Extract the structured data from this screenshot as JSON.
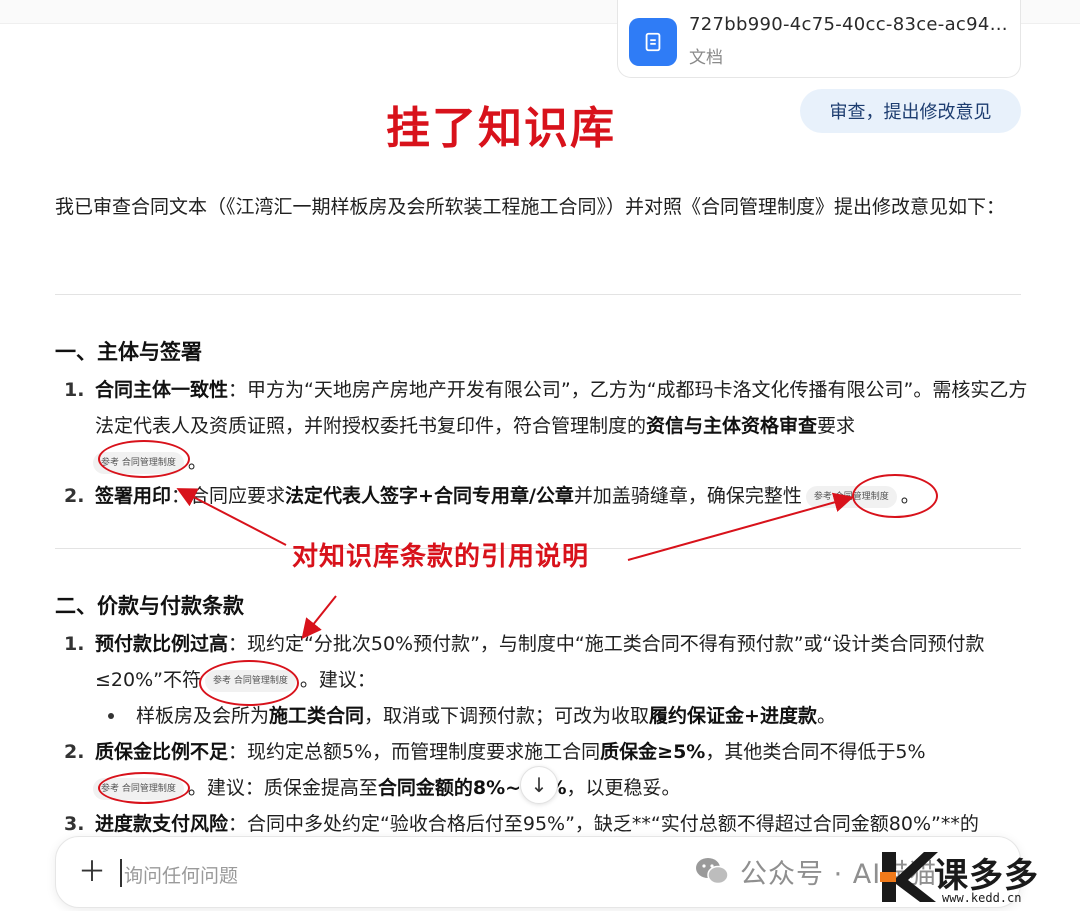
{
  "file": {
    "name": "727bb990-4c75-40cc-83ce-ac94a7...",
    "type": "文档"
  },
  "annotation": {
    "title": "挂了知识库",
    "label": "对知识库条款的引用说明",
    "color": "#d8121b"
  },
  "action_chip": {
    "label": "审查，提出修改意见"
  },
  "intro": "我已审查合同文本（《江湾汇一期样板房及会所软装工程施工合同》）并对照《合同管理制度》提出修改意见如下：",
  "reference_chip_label": "参考 合同管理制度",
  "sections": [
    {
      "title": "一、主体与签署",
      "items": [
        {
          "num": "1.",
          "lead": "合同主体一致性",
          "text1": "：甲方为“天地房产房地产开发有限公司”，乙方为“成都玛卡洛文化传播有限公司”。需核实乙方法定代表人及资质证照，并附授权委托书复印件，符合管理制度的",
          "bold1": "资信与主体资格审查",
          "text2": "要求",
          "text3": "。"
        },
        {
          "num": "2.",
          "lead": "签署用印",
          "text1": "：合同应要求",
          "bold1": "法定代表人签字+合同专用章/公章",
          "text2": "并加盖骑缝章，确保完整性",
          "text3": "。"
        }
      ]
    },
    {
      "title": "二、价款与付款条款",
      "items": [
        {
          "num": "1.",
          "lead": "预付款比例过高",
          "text1": "：现约定“分批次50%预付款”，与制度中“施工类合同不得有预付款”或“设计类合同预付款≤20%”不符",
          "text2": "。建议：",
          "bullet": {
            "text1": "样板房及会所为",
            "bold1": "施工类合同",
            "text2": "，取消或下调预付款；可改为收取",
            "bold2": "履约保证金+进度款",
            "text3": "。"
          }
        },
        {
          "num": "2.",
          "lead": "质保金比例不足",
          "text1": "：现约定总额5%，而管理制度要求施工合同",
          "bold1": "质保金≥5%",
          "text2": "，其他类合同不得低于5%",
          "text3": "。建议：质保金提高至",
          "bold2": "合同金额的8%~10%",
          "text4": "，以更稳妥。"
        },
        {
          "num": "3.",
          "lead": "进度款支付风险",
          "text1": "：合同中多处约定“验收合格后付至95%”，缺乏**“实付总额不得超过合同金额80%”**的"
        }
      ]
    }
  ],
  "input": {
    "placeholder": "询问任何问题"
  },
  "watermark": {
    "text": "公众号 · AI猫猫"
  },
  "logo": {
    "name": "课多多",
    "url": "www.kedd.cn"
  }
}
